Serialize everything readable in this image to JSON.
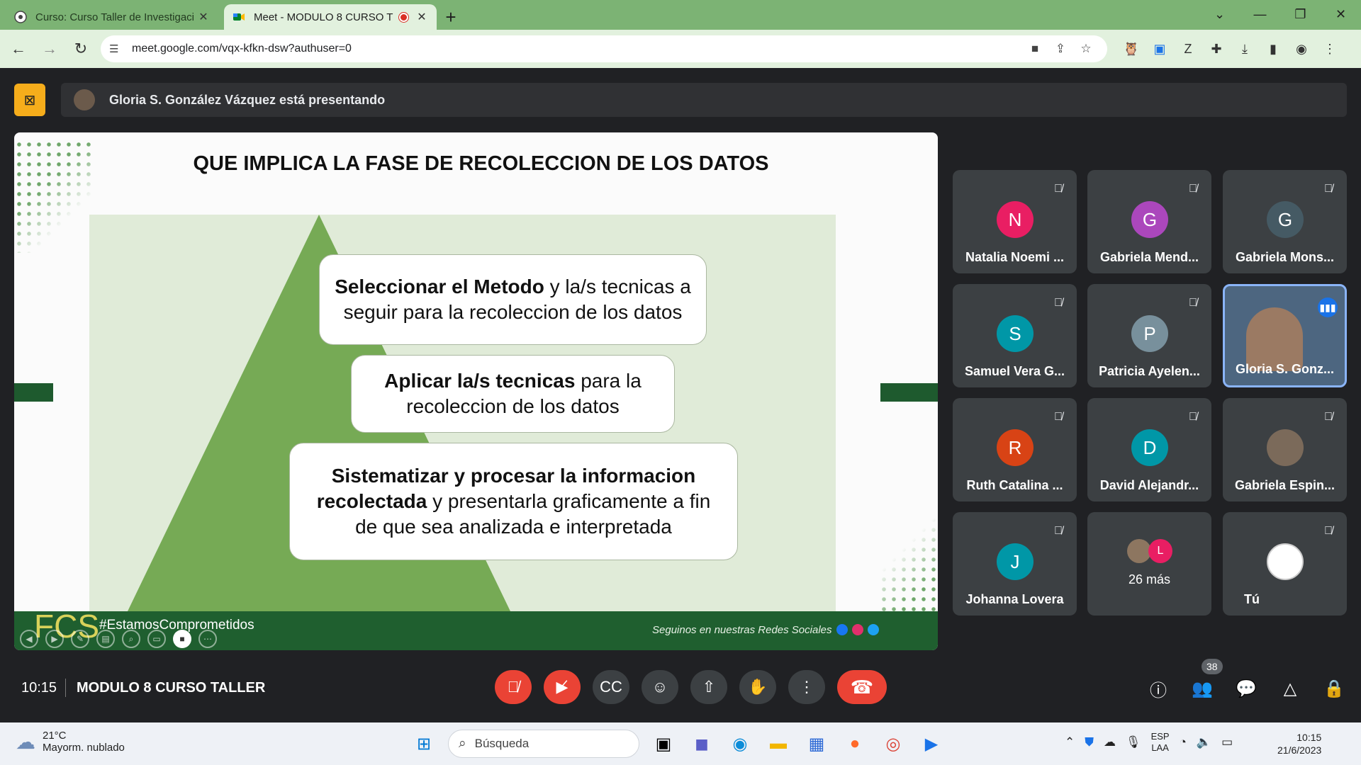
{
  "browser": {
    "tabs": [
      {
        "label": "Curso: Curso Taller de Investigaci",
        "active": false
      },
      {
        "label": "Meet - MODULO 8 CURSO T",
        "active": true
      }
    ],
    "new_tab": "+",
    "url": "meet.google.com/vqx-kfkn-dsw?authuser=0"
  },
  "meet": {
    "presenter_text": "Gloria S. González Vázquez está presentando",
    "time": "10:15",
    "meeting_name": "MODULO 8 CURSO TALLER",
    "participant_count": "38",
    "accent_color": "#ea4335"
  },
  "slide": {
    "title": "QUE IMPLICA LA FASE DE RECOLECCION DE LOS DATOS",
    "box1_bold": "Seleccionar el Metodo",
    "box1_rest": " y la/s tecnicas a seguir para la recoleccion de los datos",
    "box2_bold": "Aplicar la/s tecnicas",
    "box2_rest": " para la recoleccion de los datos",
    "box3_bold": "Sistematizar  y procesar la informacion recolectada",
    "box3_rest": " y presentarla graficamente a fin de que  sea analizada e interpretada",
    "logo": "FCS",
    "hashtag": "#EstamosComprometidos",
    "social_text": "Seguinos en nuestras Redes Sociales"
  },
  "participants": [
    {
      "initial": "N",
      "name": "Natalia Noemi ...",
      "color": "#e91e63",
      "muted": true
    },
    {
      "initial": "G",
      "name": "Gabriela Mend...",
      "color": "#ab47bc",
      "muted": true
    },
    {
      "initial": "G",
      "name": "Gabriela Mons...",
      "color": "#455a64",
      "muted": true
    },
    {
      "initial": "S",
      "name": "Samuel Vera G...",
      "color": "#0097a7",
      "muted": true
    },
    {
      "initial": "P",
      "name": "Patricia Ayelen...",
      "color": "#78909c",
      "muted": true
    },
    {
      "initial": "",
      "name": "Gloria S. Gonz...",
      "color": "#4d6680",
      "muted": false
    },
    {
      "initial": "R",
      "name": "Ruth Catalina ...",
      "color": "#d84315",
      "muted": true
    },
    {
      "initial": "D",
      "name": "David Alejandr...",
      "color": "#0097a7",
      "muted": true
    },
    {
      "initial": "",
      "name": "Gabriela Espin...",
      "color": "#7b6a5a",
      "muted": true
    },
    {
      "initial": "J",
      "name": "Johanna Lovera",
      "color": "#0097a7",
      "muted": true
    },
    {
      "initial": "L",
      "name": "26 más",
      "color": "#e91e63",
      "muted": false
    },
    {
      "initial": "",
      "name": "Tú",
      "color": "#ffffff",
      "muted": true
    }
  ],
  "taskbar": {
    "temperature": "21°C",
    "weather": "Mayorm. nublado",
    "search_placeholder": "Búsqueda",
    "lang1": "ESP",
    "lang2": "LAA",
    "clock_time": "10:15",
    "clock_date": "21/6/2023"
  }
}
